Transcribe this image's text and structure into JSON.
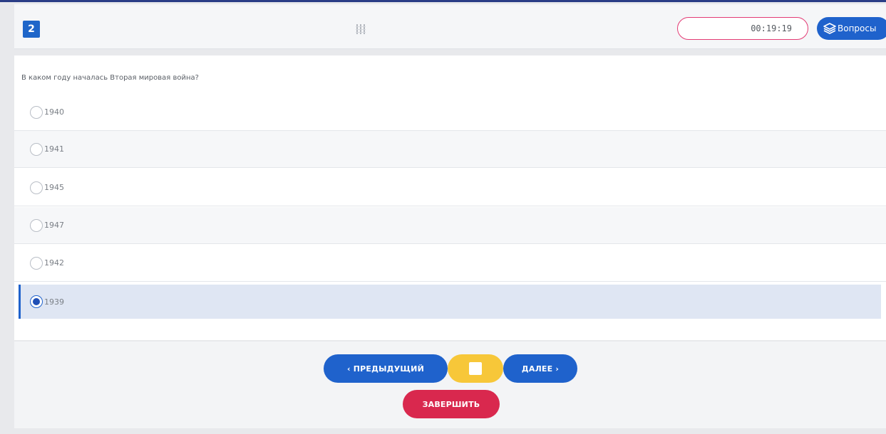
{
  "header": {
    "question_number": "2",
    "timer": "00:19:19",
    "questions_button": "Вопросы"
  },
  "question": {
    "text": "В каком году началась Вторая мировая война?",
    "options": [
      {
        "label": "1940",
        "selected": false
      },
      {
        "label": "1941",
        "selected": false
      },
      {
        "label": "1945",
        "selected": false
      },
      {
        "label": "1947",
        "selected": false
      },
      {
        "label": "1942",
        "selected": false
      },
      {
        "label": "1939",
        "selected": true
      }
    ]
  },
  "footer": {
    "prev_label": "‹ ПРЕДЫДУЩИЙ",
    "next_label": "ДАЛЕЕ ›",
    "finish_label": "ЗАВЕРШИТЬ"
  },
  "colors": {
    "primary": "#1f62cc",
    "timer_border": "#e33a74",
    "flag_yellow": "#f7c739",
    "finish_red": "#d9284e",
    "selected_bg": "#dfe6f3"
  },
  "icons": {
    "grip": "drag-handle-icon",
    "questions": "layers-icon",
    "flag": "square-icon"
  }
}
